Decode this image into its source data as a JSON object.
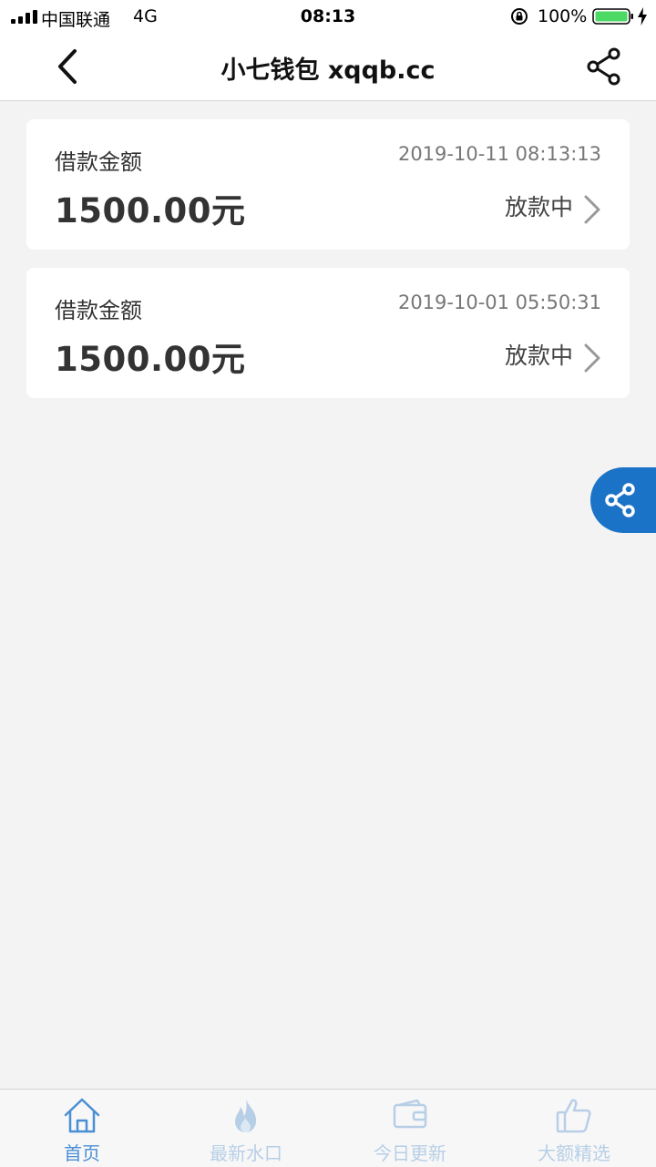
{
  "status_bar": {
    "carrier": "中国联通",
    "network": "4G",
    "time": "08:13",
    "battery": "100%"
  },
  "nav": {
    "title": "小七钱包 xqqb.cc",
    "back_icon": "chevron-left-icon",
    "share_icon": "share-icon"
  },
  "loans": [
    {
      "label": "借款金额",
      "time": "2019-10-11 08:13:13",
      "amount": "1500.00元",
      "status": "放款中"
    },
    {
      "label": "借款金额",
      "time": "2019-10-01 05:50:31",
      "amount": "1500.00元",
      "status": "放款中"
    }
  ],
  "tabs": [
    {
      "label": "首页",
      "icon": "home-icon",
      "active": true
    },
    {
      "label": "最新水口",
      "icon": "flame-icon",
      "active": false
    },
    {
      "label": "今日更新",
      "icon": "wallet-icon",
      "active": false
    },
    {
      "label": "大额精选",
      "icon": "thumbs-up-icon",
      "active": false
    }
  ],
  "colors": {
    "accent": "#1a73c6",
    "tab_active": "#4a8fd3",
    "tab_inactive": "#b7cfe6",
    "background": "#f3f3f4"
  }
}
